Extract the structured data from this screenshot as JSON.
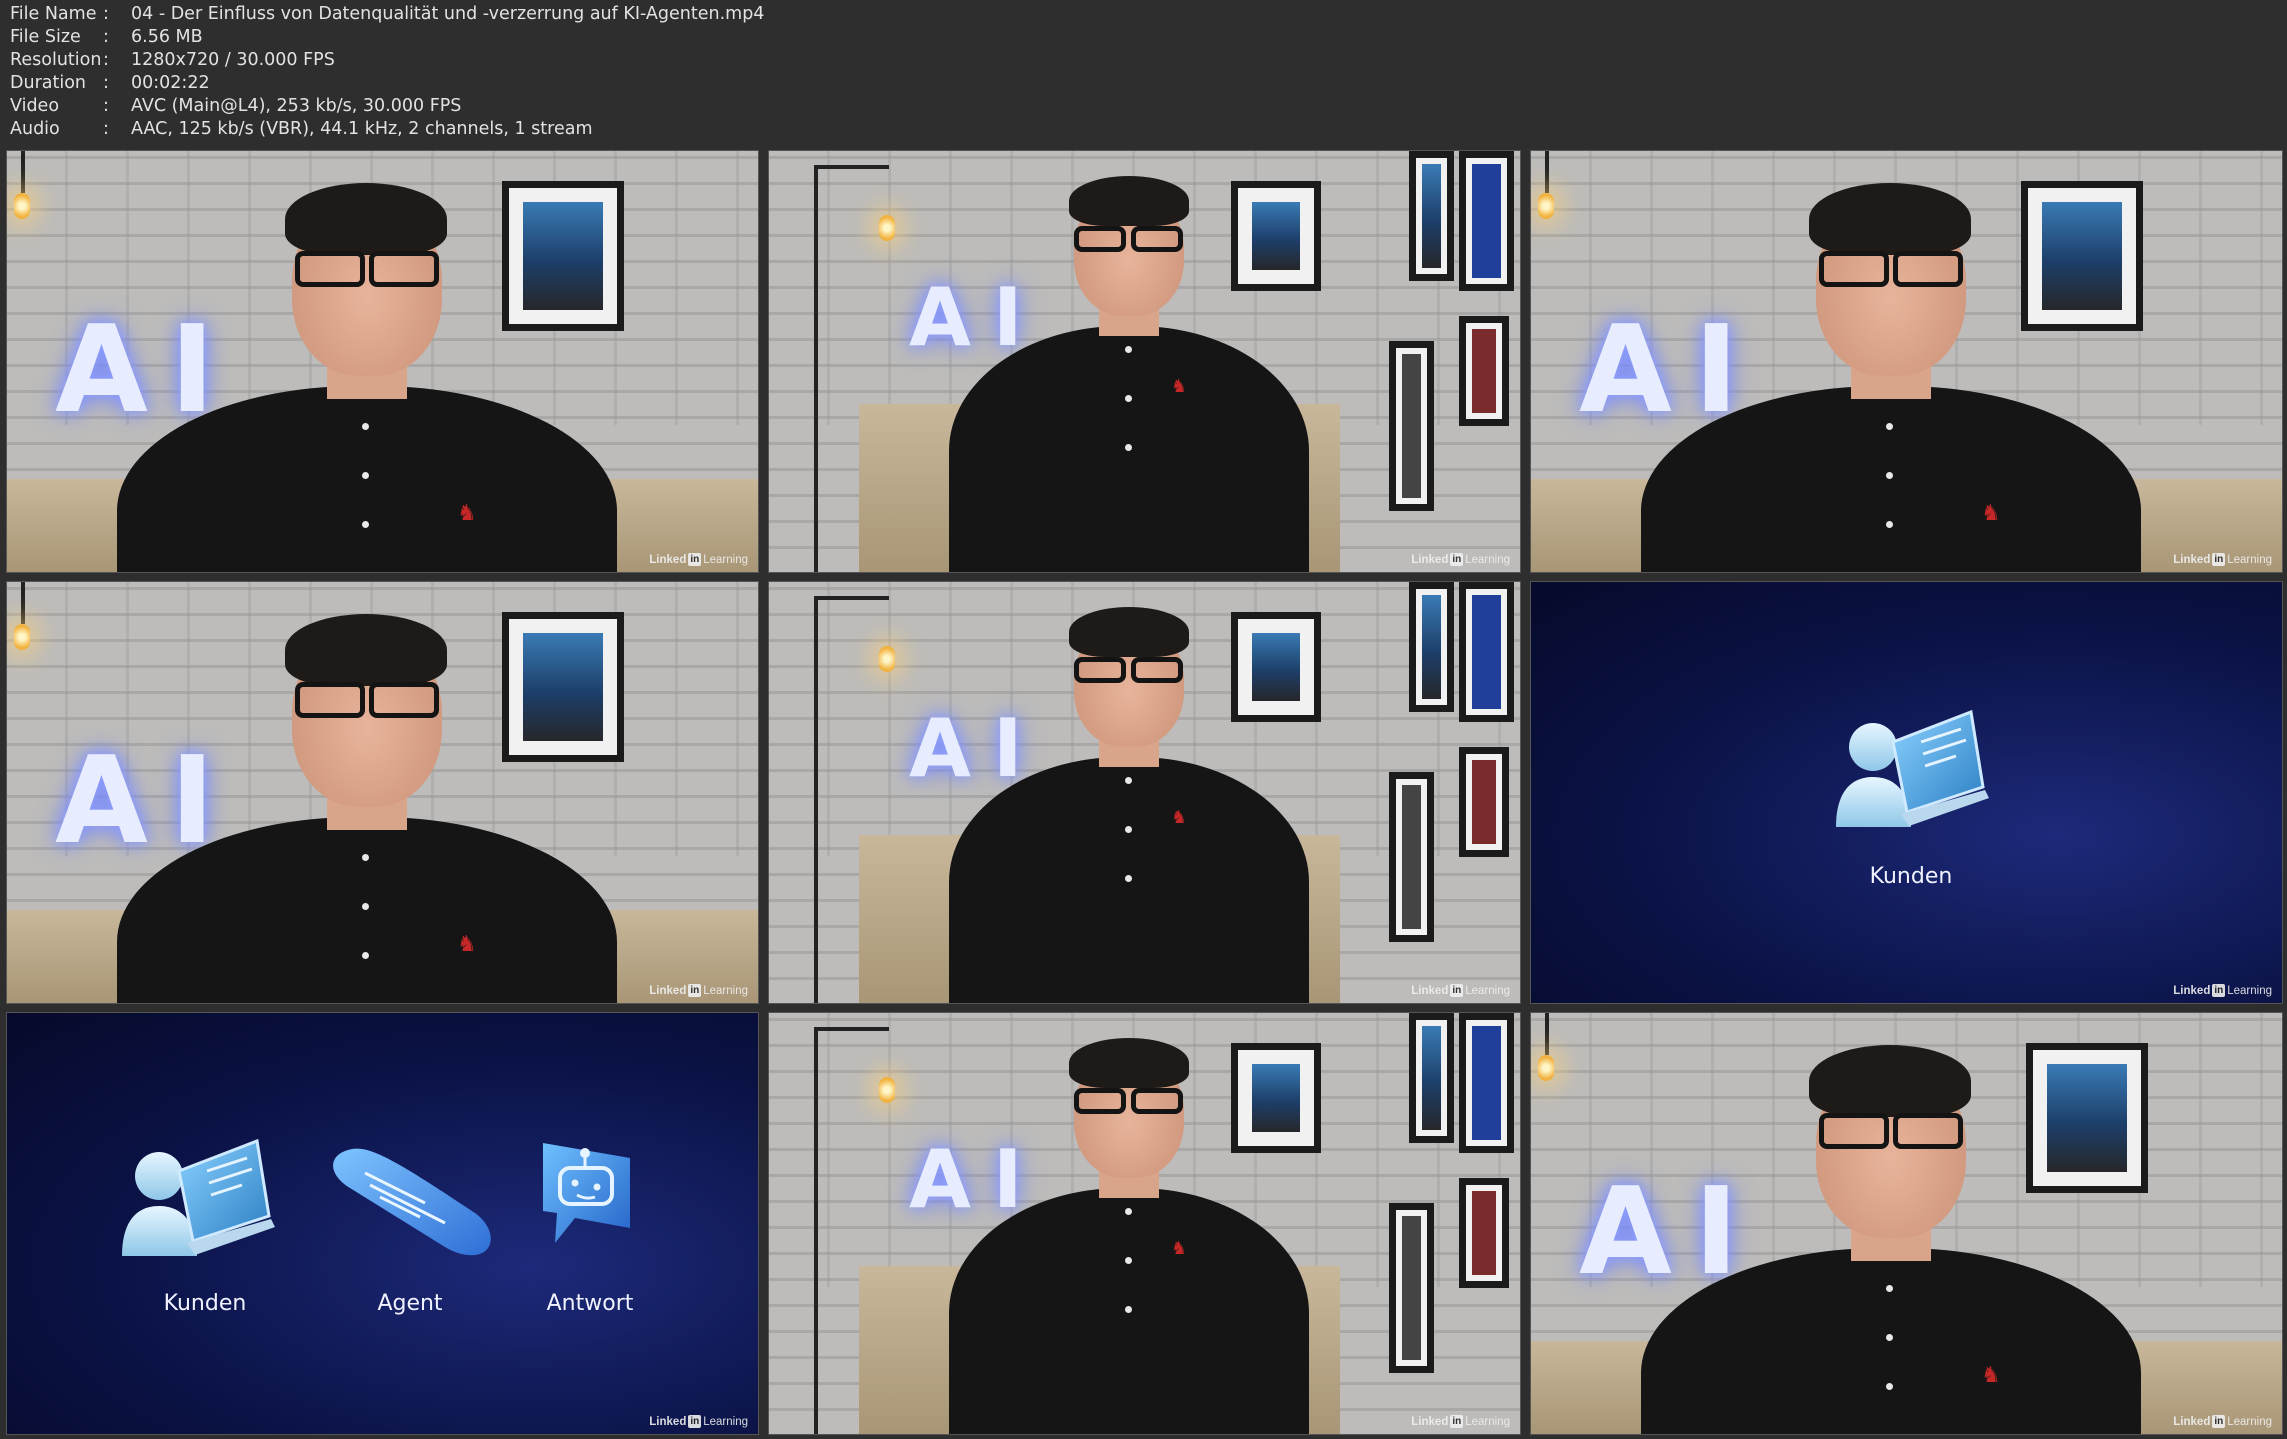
{
  "media_info": {
    "rows": [
      {
        "key": "File Name",
        "sep": ":",
        "value": "04 - Der Einfluss von Datenqualität und -verzerrung auf KI-Agenten.mp4"
      },
      {
        "key": "File Size",
        "sep": ":",
        "value": "6.56 MB"
      },
      {
        "key": "Resolution",
        "sep": ":",
        "value": "1280x720 / 30.000 FPS"
      },
      {
        "key": "Duration",
        "sep": ":",
        "value": "00:02:22"
      },
      {
        "key": "Video",
        "sep": ":",
        "value": "AVC (Main@L4), 253 kb/s, 30.000 FPS"
      },
      {
        "key": "Audio",
        "sep": ":",
        "value": "AAC, 125 kb/s (VBR), 44.1 kHz, 2 channels, 1 stream"
      }
    ]
  },
  "thumbnails": {
    "neon_text": "AI",
    "watermark": {
      "brand": "Linked",
      "in": "in",
      "suffix": "Learning"
    },
    "slide1": {
      "label": "Kunden",
      "icon": "customer-laptop-icon"
    },
    "slide2": {
      "labels": [
        "Kunden",
        "Agent",
        "Antwort"
      ],
      "icons": [
        "customer-laptop-icon",
        "chat-bubble-icon",
        "robot-chat-icon"
      ]
    }
  },
  "colors": {
    "background": "#2e2e2e",
    "info_text": "#e2e2e2",
    "slide_bg": "#0b1347",
    "neon": "#e8ecff",
    "shirt_logo": "#c62828"
  }
}
